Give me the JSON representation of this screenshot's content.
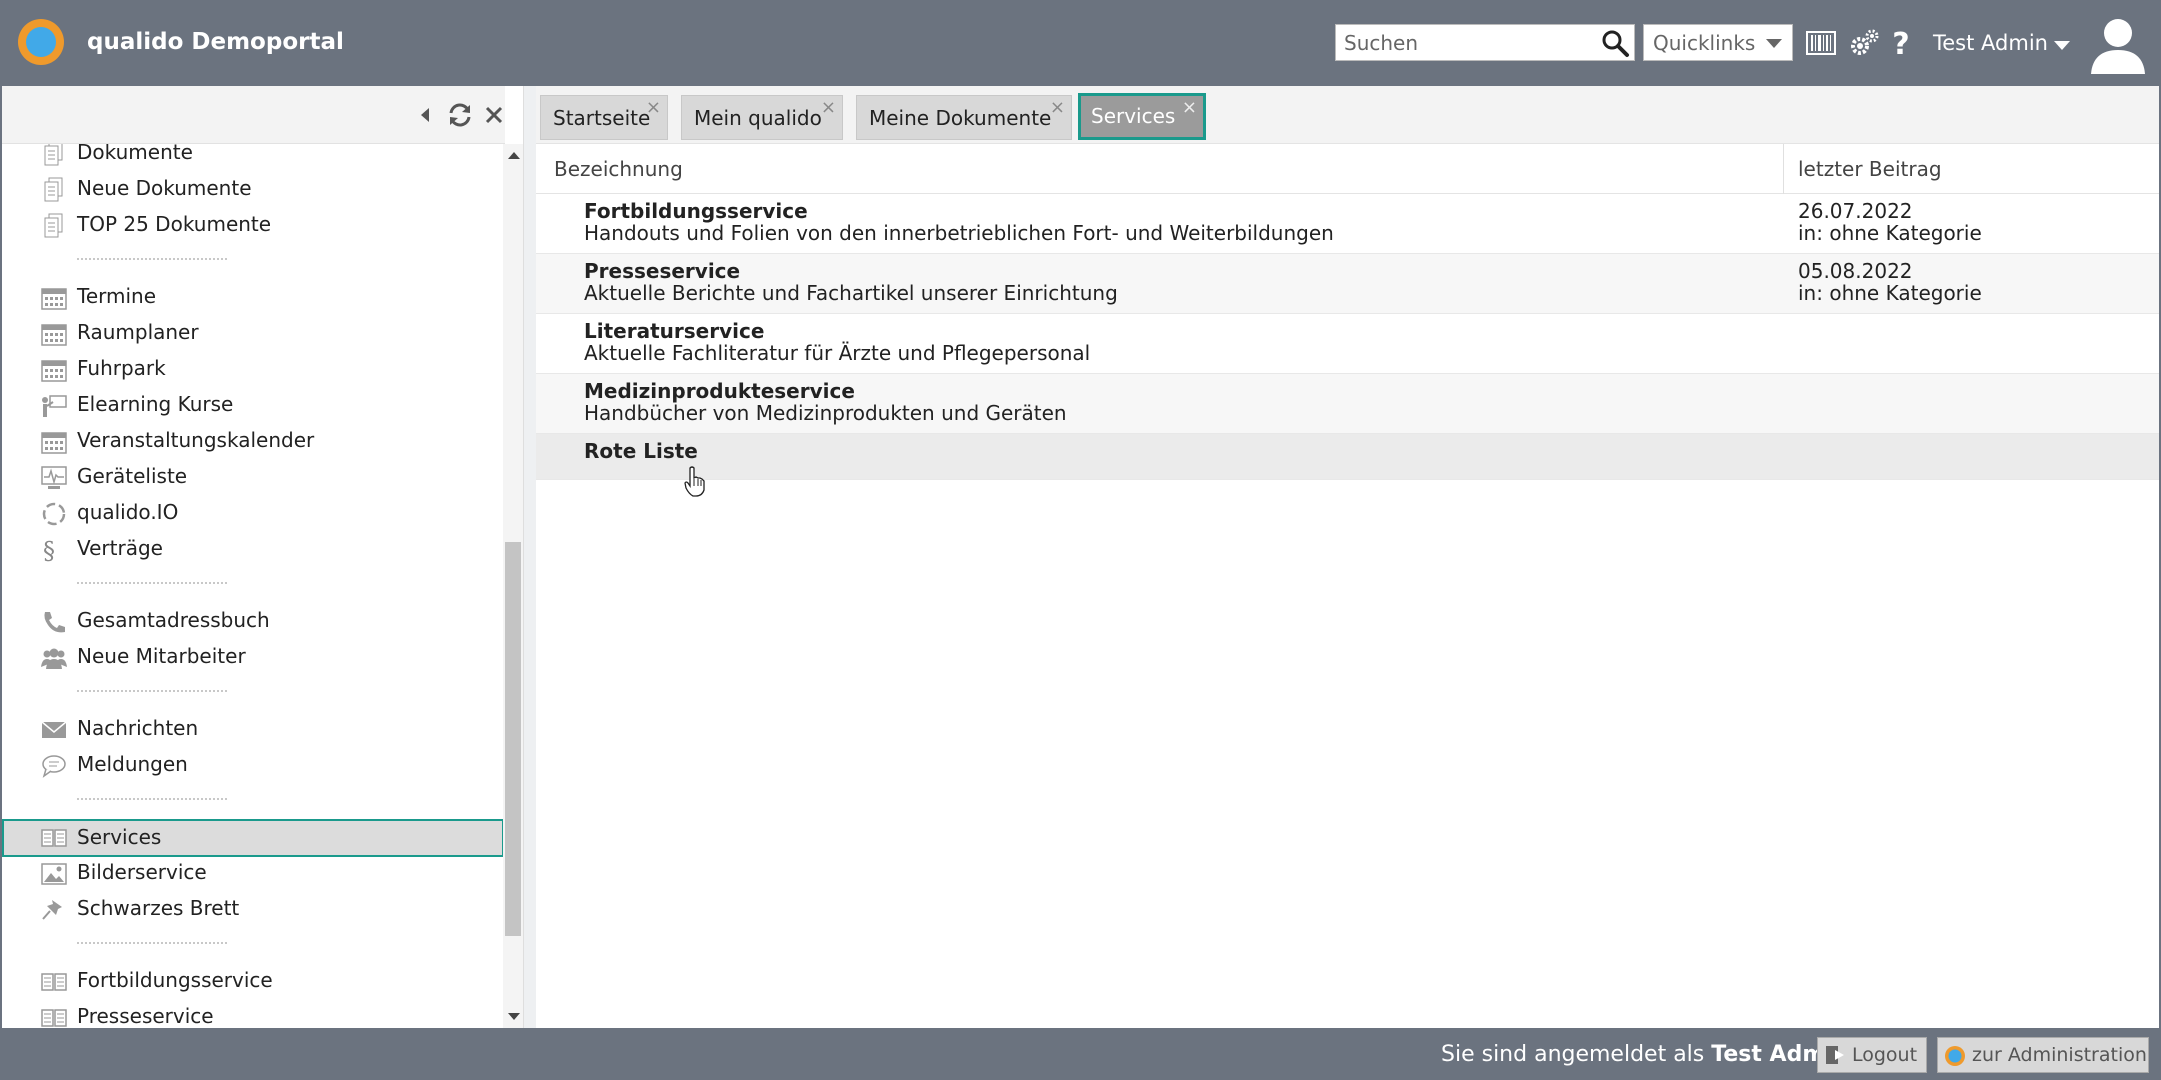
{
  "header": {
    "app_title": "qualido Demoportal",
    "search_placeholder": "Suchen",
    "quicklinks_label": "Quicklinks",
    "user_name": "Test Admin",
    "icons": [
      "barcode-icon",
      "settings-gears-icon",
      "help-icon",
      "user-avatar-icon"
    ]
  },
  "sidebar": {
    "tools": [
      "collapse-left-icon",
      "refresh-icon",
      "close-icon"
    ],
    "items": [
      {
        "label": "Dokumente",
        "icon": "document-icon"
      },
      {
        "label": "Neue Dokumente",
        "icon": "document-icon"
      },
      {
        "label": "TOP 25 Dokumente",
        "icon": "document-icon"
      },
      {
        "label": "Termine",
        "icon": "calendar-icon"
      },
      {
        "label": "Raumplaner",
        "icon": "calendar-icon"
      },
      {
        "label": "Fuhrpark",
        "icon": "calendar-icon"
      },
      {
        "label": "Elearning Kurse",
        "icon": "presentation-icon"
      },
      {
        "label": "Veranstaltungskalender",
        "icon": "calendar-icon"
      },
      {
        "label": "Geräteliste",
        "icon": "device-monitor-icon"
      },
      {
        "label": "qualido.IO",
        "icon": "circle-arrows-icon"
      },
      {
        "label": "Verträge",
        "icon": "paragraph-icon"
      },
      {
        "label": "Gesamtadressbuch",
        "icon": "phone-icon"
      },
      {
        "label": "Neue Mitarbeiter",
        "icon": "users-icon"
      },
      {
        "label": "Nachrichten",
        "icon": "envelope-icon"
      },
      {
        "label": "Meldungen",
        "icon": "speech-bubble-icon"
      },
      {
        "label": "Services",
        "icon": "book-icon",
        "active": true
      },
      {
        "label": "Bilderservice",
        "icon": "image-icon"
      },
      {
        "label": "Schwarzes Brett",
        "icon": "pin-icon"
      },
      {
        "label": "Fortbildungsservice",
        "icon": "book-icon"
      },
      {
        "label": "Presseservice",
        "icon": "book-icon"
      }
    ]
  },
  "tabs": [
    {
      "label": "Startseite",
      "close": "×"
    },
    {
      "label": "Mein qualido",
      "close": "×"
    },
    {
      "label": "Meine Dokumente",
      "close": "×"
    },
    {
      "label": "Services",
      "close": "×",
      "active": true
    }
  ],
  "table": {
    "columns": [
      "Bezeichnung",
      "letzter Beitrag"
    ],
    "rows": [
      {
        "title": "Fortbildungsservice",
        "desc": "Handouts und Folien von den innerbetrieblichen Fort- und Weiterbildungen",
        "date": "26.07.2022",
        "category": "in: ohne Kategorie"
      },
      {
        "title": "Presseservice",
        "desc": "Aktuelle Berichte und Fachartikel unserer Einrichtung",
        "date": "05.08.2022",
        "category": "in: ohne Kategorie"
      },
      {
        "title": "Literaturservice",
        "desc": "Aktuelle Fachliteratur für Ärzte und Pflegepersonal",
        "date": "",
        "category": ""
      },
      {
        "title": "Medizinprodukteservice",
        "desc": "Handbücher von Medizinprodukten und Geräten",
        "date": "",
        "category": ""
      },
      {
        "title": "Rote Liste",
        "desc": "",
        "date": "",
        "category": ""
      }
    ]
  },
  "footer": {
    "logged_in_prefix": "Sie sind angemeldet als",
    "logged_in_user": "Test Admin",
    "logout_label": "Logout",
    "admin_label": "zur Administration"
  },
  "colors": {
    "bar": "#6b737f",
    "accent": "#1a9a8c",
    "logo_outer": "#ef9a2c",
    "logo_inner": "#41a9e8"
  }
}
